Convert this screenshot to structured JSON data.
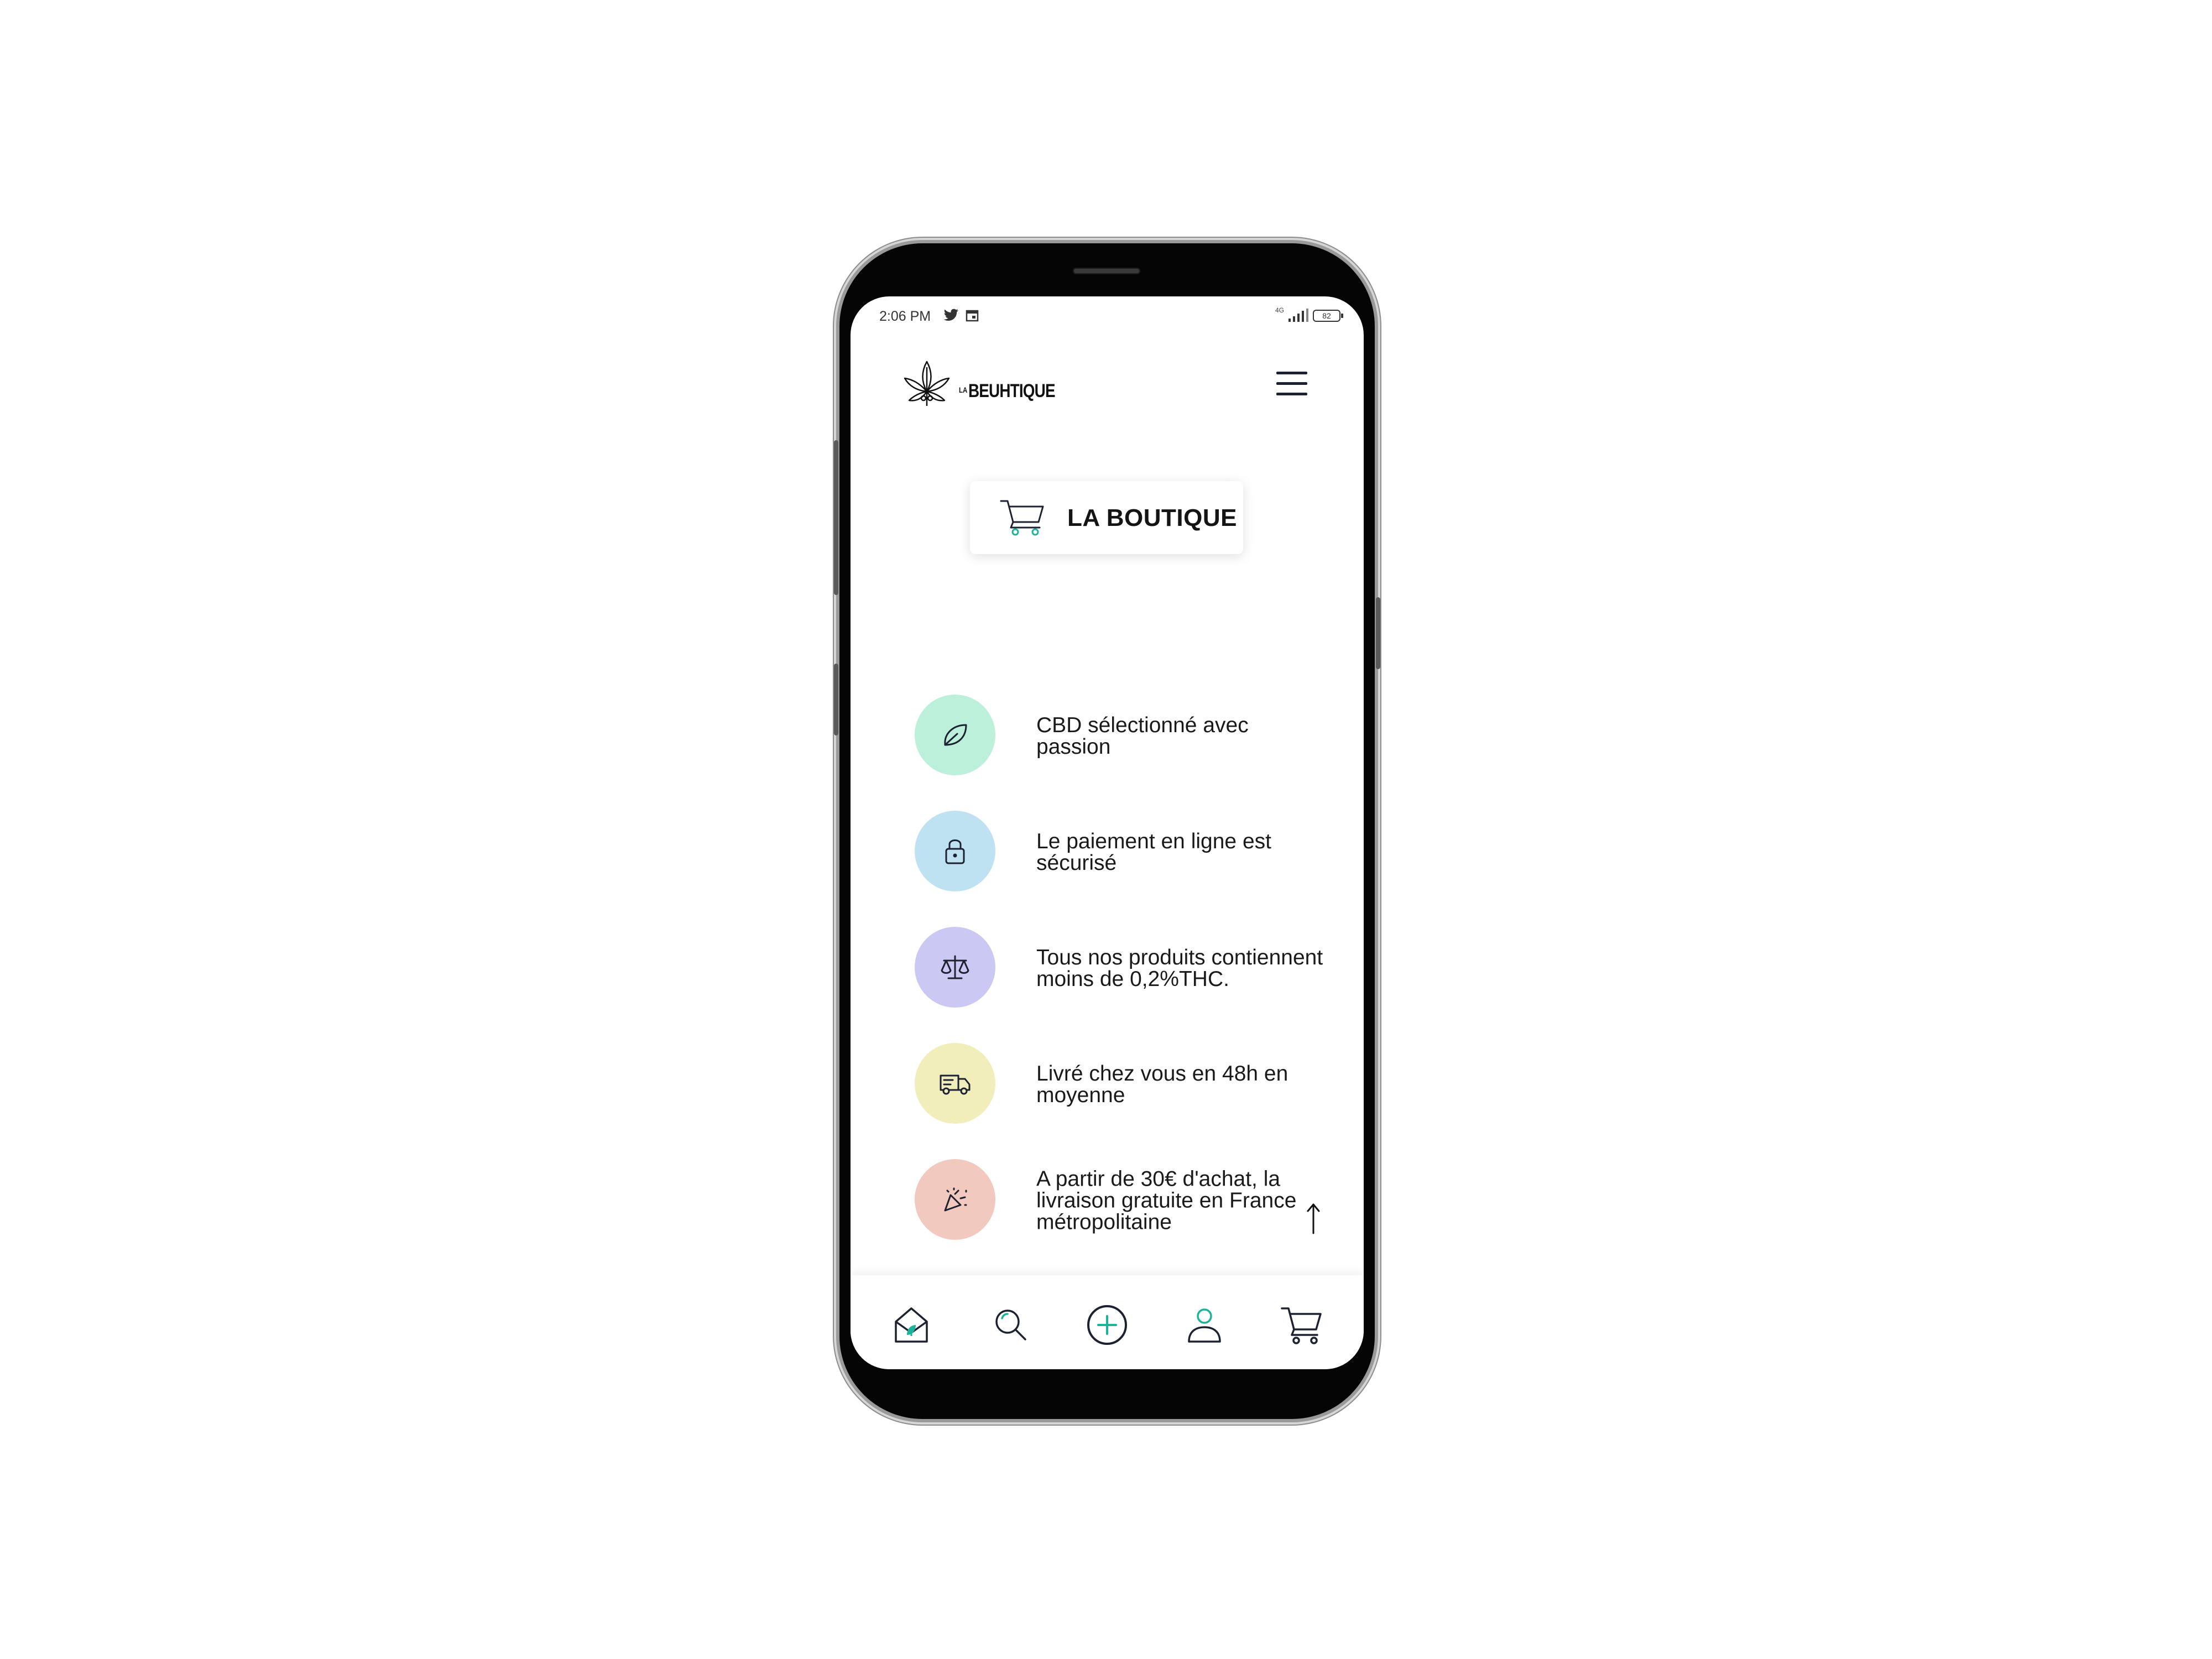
{
  "status_bar": {
    "time": "2:06 PM",
    "network": "4G",
    "battery": "82"
  },
  "header": {
    "logo_prefix": "LA",
    "logo_name": "BEUHTIQUE",
    "menu_icon": "hamburger-menu-icon"
  },
  "shop_button": {
    "label": "LA BOUTIQUE",
    "icon": "shopping-cart-icon"
  },
  "features": [
    {
      "text": "CBD sélectionné avec passion",
      "icon": "leaf-icon",
      "color": "#bdf0db"
    },
    {
      "text": "Le paiement en ligne est sécurisé",
      "icon": "lock-icon",
      "color": "#bfe2f2"
    },
    {
      "text": "Tous nos produits contiennent moins de 0,2%THC.",
      "icon": "scale-icon",
      "color": "#cbc9f3"
    },
    {
      "text": "Livré chez vous en 48h en moyenne",
      "icon": "truck-icon",
      "color": "#f2eebb"
    },
    {
      "text": "A partir de 30€ d'achat, la livraison gratuite en France métropolitaine",
      "icon": "party-popper-icon",
      "color": "#f2c9bf"
    }
  ],
  "bottom_nav": [
    {
      "icon": "home-icon"
    },
    {
      "icon": "search-icon"
    },
    {
      "icon": "add-circle-icon"
    },
    {
      "icon": "user-icon"
    },
    {
      "icon": "cart-icon"
    }
  ],
  "colors": {
    "accent": "#1bb39a",
    "dark": "#1c2230"
  }
}
